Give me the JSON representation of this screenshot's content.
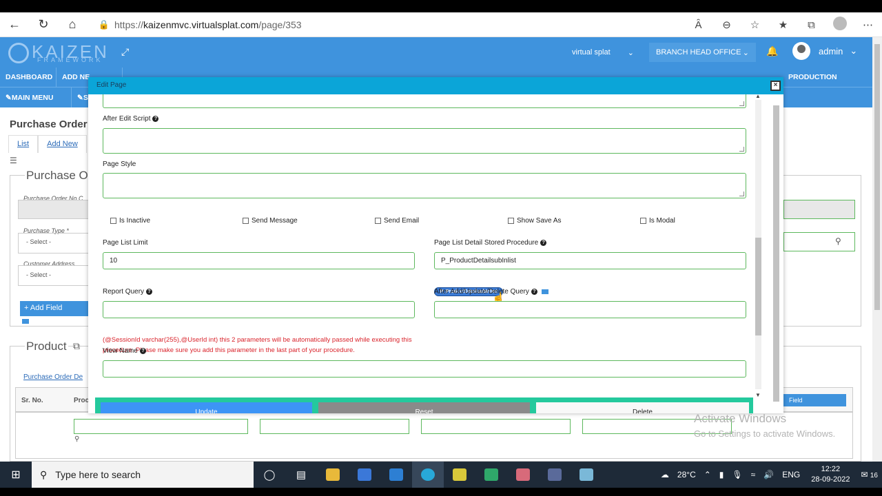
{
  "browser": {
    "url_prefix": "https://",
    "url_host": "kaizenmvc.virtualsplat.com",
    "url_path": "/page/353"
  },
  "header": {
    "logo_text": "KAIZEN",
    "logo_sub": "FRAMEWORK",
    "company_select": "virtual splat",
    "branch_select": "BRANCH HEAD OFFICE",
    "user_name": "admin"
  },
  "menu": {
    "row1": [
      "DASHBOARD",
      "ADD NE"
    ],
    "production": "PRODUCTION",
    "row2_main": "MAIN MENU",
    "row2_second": "S"
  },
  "background_page": {
    "title": "Purchase Order",
    "tab_list": "List",
    "tab_add_new": "Add New",
    "section_title": "Purchase O",
    "purchase_order_no": "Purchase Order No C",
    "purchase_type": "Purchase Type *",
    "customer_address": "Customer Address",
    "select_placeholder": "- Select -",
    "add_field": "Add Field",
    "product_title": "Product",
    "purchase_order_detail": "Purchase Order De",
    "col_sr_no": "Sr. No.",
    "col_prod": "Proc",
    "field_btn": "Field"
  },
  "modal": {
    "title": "Edit Page",
    "after_edit_script_label": "After Edit Script",
    "page_style_label": "Page Style",
    "checkboxes": [
      "Is Inactive",
      "Send Message",
      "Send Email",
      "Show Save As",
      "Is Modal"
    ],
    "page_list_limit_label": "Page List Limit",
    "page_list_limit_value": "10",
    "stored_proc_label": "Page List Detail Stored Procedure",
    "stored_proc_value": "P_ProductDetailsubInlist",
    "stored_proc_pill": "P_ProductDetailsubInlist",
    "report_query_label": "Report Query",
    "after_query_label": "After Add/Update/Delete Query",
    "report_query_note": "(@SessionId varchar(255),@UserId int) this 2 parameters will be automatically passed while executing this procedure. Please make sure you add this parameter in the last part of your procedure.",
    "view_name_label": "View Name",
    "btn_update": "Update",
    "btn_reset": "Reset",
    "btn_delete": "Delete"
  },
  "watermark": {
    "line1": "Activate Windows",
    "line2": "Go to Settings to activate Windows."
  },
  "taskbar": {
    "search_placeholder": "Type here to search",
    "weather": "28°C",
    "lang": "ENG",
    "time": "12:22",
    "date": "28-09-2022",
    "notifications": "16"
  },
  "colors": {
    "app_blue": "#3f93dd",
    "modal_header": "#0ba5d8",
    "field_border": "#5cb85c",
    "update_btn": "#3d94f6",
    "reset_btn": "#8a8a8a",
    "button_bar": "#24c99d",
    "error_text": "#d9232b"
  }
}
